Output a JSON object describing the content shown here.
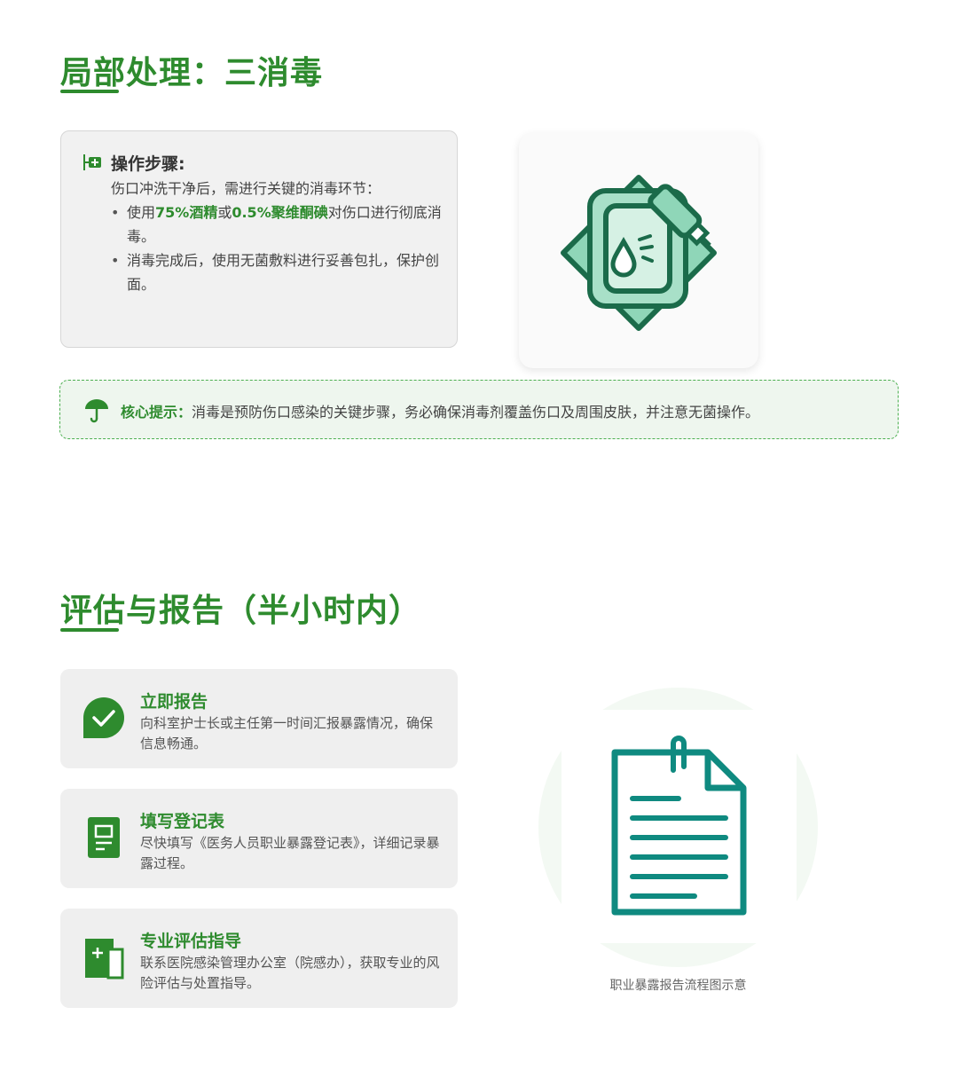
{
  "section1": {
    "title": "局部处理：三消毒",
    "steps": {
      "title": "操作步骤:",
      "intro": "伤口冲洗干净后，需进行关键的消毒环节：",
      "bullet1": {
        "p1": "使用",
        "h1": "75%酒精",
        "p2": "或",
        "h2": "0.5%聚维酮碘",
        "p3": "对伤口进行彻底消毒。"
      },
      "bullet2": "消毒完成后，使用无菌敷料进行妥善包扎，保护创面。"
    },
    "tip": {
      "label": "核心提示：",
      "text": "消毒是预防伤口感染的关键步骤，务必确保消毒剂覆盖伤口及周围皮肤，并注意无菌操作。"
    }
  },
  "section2": {
    "title": "评估与报告（半小时内）",
    "items": [
      {
        "title": "立即报告",
        "desc": "向科室护士长或主任第一时间汇报暴露情况，确保信息畅通。",
        "icon": "chat-check-icon"
      },
      {
        "title": "填写登记表",
        "desc": "尽快填写《医务人员职业暴露登记表》，详细记录暴露过程。",
        "icon": "form-icon"
      },
      {
        "title": "专业评估指导",
        "desc": "联系医院感染管理办公室（院感办），获取专业的风险评估与处置指导。",
        "icon": "medical-file-icon"
      }
    ],
    "caption": "职业暴露报告流程图示意"
  },
  "colors": {
    "accent": "#2e8b2e",
    "teal": "#0f8a80",
    "dark_green": "#1b6b4a"
  }
}
